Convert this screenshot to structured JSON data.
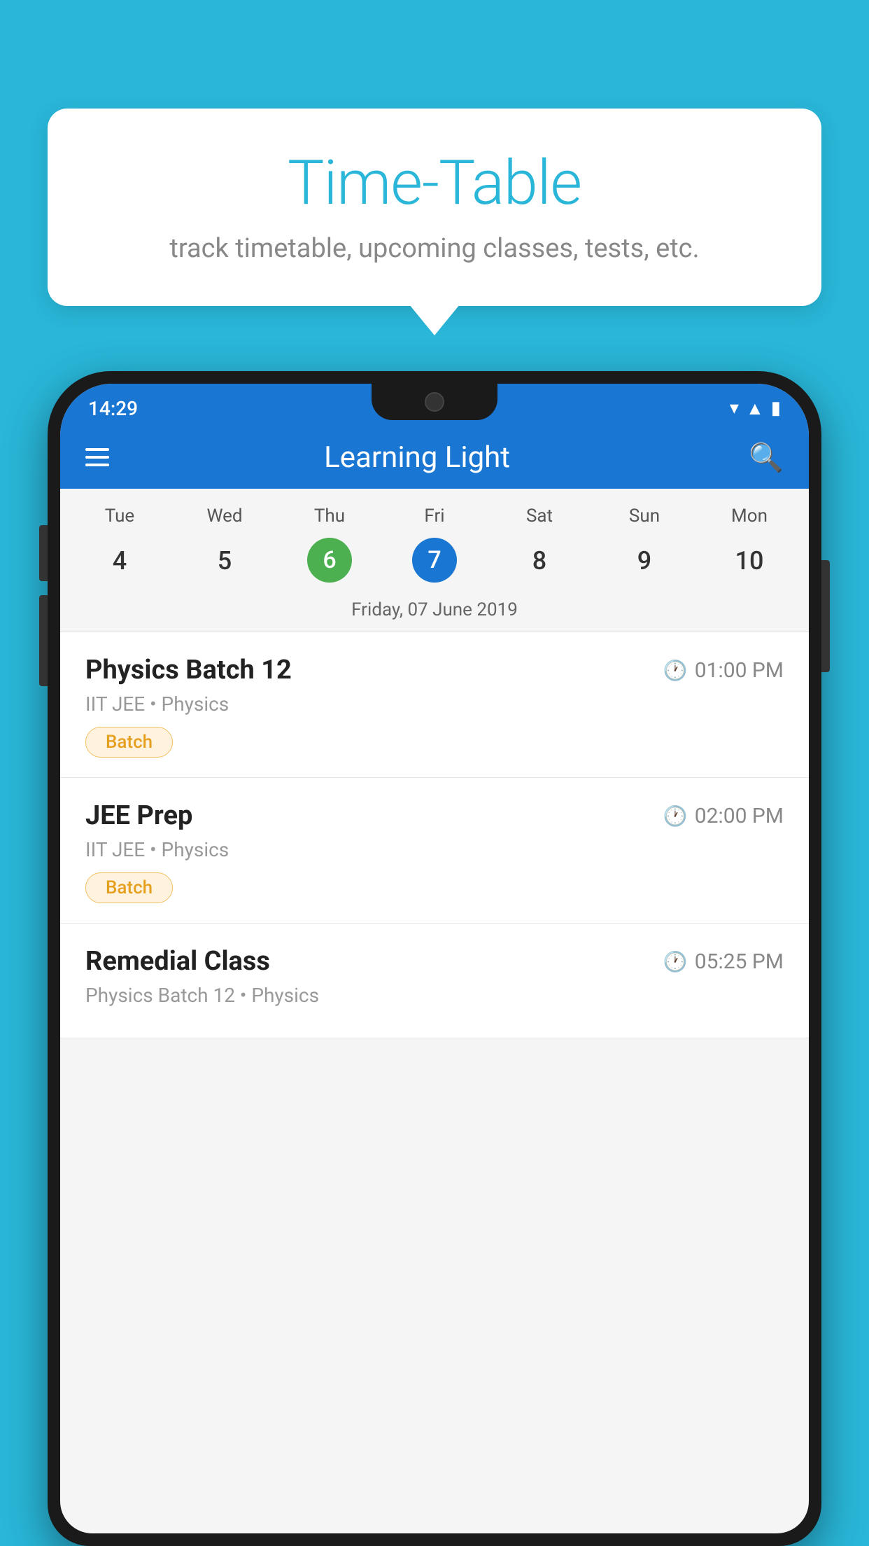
{
  "background_color": "#29B6D8",
  "tooltip": {
    "title": "Time-Table",
    "subtitle": "track timetable, upcoming classes, tests, etc."
  },
  "phone": {
    "status_bar": {
      "time": "14:29"
    },
    "header": {
      "title": "Learning Light"
    },
    "calendar": {
      "day_labels": [
        "Tue",
        "Wed",
        "Thu",
        "Fri",
        "Sat",
        "Sun",
        "Mon"
      ],
      "day_numbers": [
        "4",
        "5",
        "6",
        "7",
        "8",
        "9",
        "10"
      ],
      "today_index": 2,
      "selected_index": 3,
      "selected_date_label": "Friday, 07 June 2019"
    },
    "schedule_items": [
      {
        "title": "Physics Batch 12",
        "time": "01:00 PM",
        "subtitle": "IIT JEE • Physics",
        "badge": "Batch"
      },
      {
        "title": "JEE Prep",
        "time": "02:00 PM",
        "subtitle": "IIT JEE • Physics",
        "badge": "Batch"
      },
      {
        "title": "Remedial Class",
        "time": "05:25 PM",
        "subtitle": "Physics Batch 12 • Physics",
        "badge": null
      }
    ]
  }
}
